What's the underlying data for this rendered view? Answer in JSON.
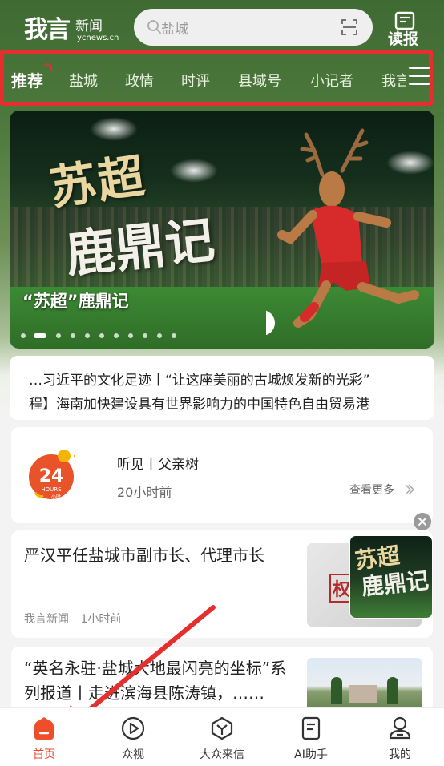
{
  "header": {
    "logo_main": "我言",
    "logo_sub": "新闻",
    "logo_url": "ycnews.cn",
    "search_placeholder": "盐城",
    "read_report_label": "读报"
  },
  "tabs": [
    "推荐",
    "盐城",
    "政情",
    "时评",
    "县域号",
    "小记者",
    "我言"
  ],
  "active_tab": "推荐",
  "banner": {
    "art_line1": "苏超",
    "art_line2": "鹿鼎记",
    "caption": "“苏超”鹿鼎记",
    "slide_count": 11,
    "active_slide": 2
  },
  "ticker": [
    "…习近平的文化足迹丨“让这座美丽的古城焕发新的光彩”",
    "程】海南加快建设具有世界影响力的中国特色自由贸易港"
  ],
  "hours_card": {
    "badge_number": "24",
    "badge_text": "HOURS",
    "badge_sub": "小时",
    "title": "听见丨父亲树",
    "time": "20小时前",
    "more_label": "查看更多"
  },
  "articles": [
    {
      "title": "严汉平任盐城市副市长、代理市长",
      "source": "我言新闻",
      "time": "1小时前",
      "thumb_text": "权"
    },
    {
      "title": "“英名永驻·盐城大地最闪亮的坐标”系列报道丨走进滨海县陈涛镇，……"
    }
  ],
  "float_promo": {
    "line1": "苏超",
    "line2": "鹿鼎记"
  },
  "bottom_nav": [
    {
      "label": "首页",
      "icon": "home-icon",
      "active": true
    },
    {
      "label": "众视",
      "icon": "play-icon",
      "active": false
    },
    {
      "label": "大众来信",
      "icon": "mail-icon",
      "active": false
    },
    {
      "label": "AI助手",
      "icon": "document-icon",
      "active": false
    },
    {
      "label": "我的",
      "icon": "user-icon",
      "active": false
    }
  ],
  "colors": {
    "accent_red": "#e62e2e",
    "nav_active": "#e8472a",
    "header_green": "#3f6a32"
  }
}
